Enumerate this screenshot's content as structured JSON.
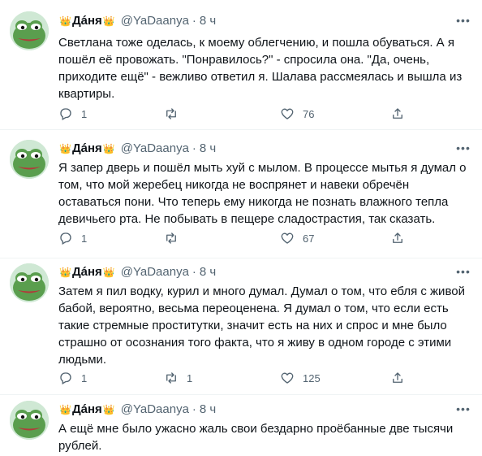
{
  "tweets": [
    {
      "author": "Дáня",
      "crown_left": "👑",
      "crown_right": "👑",
      "handle": "@YaDaanya",
      "separator": "·",
      "time": "8 ч",
      "text": "Светлана тоже оделась, к моему облегчению, и пошла обуваться. А я пошёл её провожать. \"Понравилось?\" - спросила она. \"Да, очень, приходите ещё\" - вежливо ответил я. Шалава рассмеялась и вышла из квартиры.",
      "replies": "1",
      "retweets": "",
      "likes": "76"
    },
    {
      "author": "Дáня",
      "crown_left": "👑",
      "crown_right": "👑",
      "handle": "@YaDaanya",
      "separator": "·",
      "time": "8 ч",
      "text": "Я запер дверь и пошёл мыть хуй с мылом. В процессе мытья я думал о том, что мой жеребец никогда не воспрянет и навеки обречён оставаться пони. Что теперь ему никогда не познать влажного тепла девичьего рта. Не побывать в пещере сладострастия, так сказать.",
      "replies": "1",
      "retweets": "",
      "likes": "67"
    },
    {
      "author": "Дáня",
      "crown_left": "👑",
      "crown_right": "👑",
      "handle": "@YaDaanya",
      "separator": "·",
      "time": "8 ч",
      "text": "Затем я пил водку, курил и много думал. Думал о том, что ебля с живой бабой, вероятно, весьма переоценена. Я думал о том, что если есть такие стремные проститутки, значит есть на них и спрос и мне было страшно от осознания того факта, что я живу в одном городе с этими людьми.",
      "replies": "1",
      "retweets": "1",
      "likes": "125"
    },
    {
      "author": "Дáня",
      "crown_left": "👑",
      "crown_right": "👑",
      "handle": "@YaDaanya",
      "separator": "·",
      "time": "8 ч",
      "text": "А ещё мне было ужасно жаль свои бездарно проёбанные две тысячи рублей."
    }
  ],
  "icons": {
    "more": "more-icon",
    "reply": "reply-icon",
    "retweet": "retweet-icon",
    "like": "heart-icon",
    "share": "share-icon",
    "avatar": "pepe-frog-avatar"
  },
  "colors": {
    "text": "#0f1419",
    "secondary": "#536471",
    "divider": "#eff3f4",
    "avatar_bg": "#bfe0c8",
    "frog_green": "#5a9e4e"
  }
}
